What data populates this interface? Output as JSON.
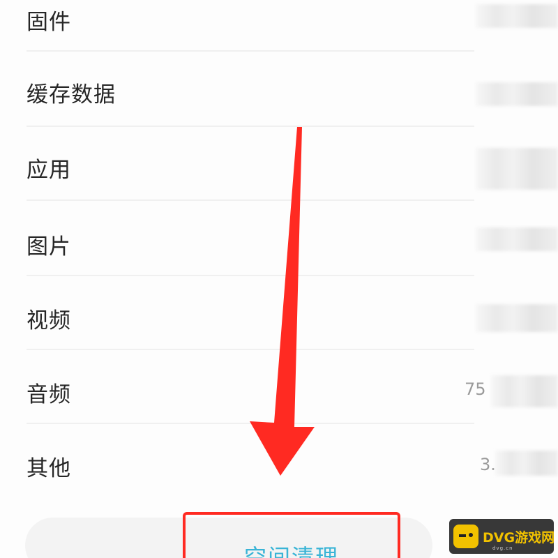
{
  "storage_list": {
    "items": [
      {
        "label": "固件",
        "value": ""
      },
      {
        "label": "缓存数据",
        "value": ""
      },
      {
        "label": "应用",
        "value": ""
      },
      {
        "label": "图片",
        "value": ""
      },
      {
        "label": "视频",
        "value": ""
      },
      {
        "label": "音频",
        "value": "75"
      },
      {
        "label": "其他",
        "value": "3."
      }
    ]
  },
  "actions": {
    "clean_label": "空间清理"
  },
  "annotation": {
    "arrow_color": "#ff2a22",
    "highlight_color": "#ff2a22"
  },
  "watermark": {
    "brand": "DVG游戏网",
    "sub": "dvg.cn"
  },
  "colors": {
    "accent": "#39b4d6"
  }
}
